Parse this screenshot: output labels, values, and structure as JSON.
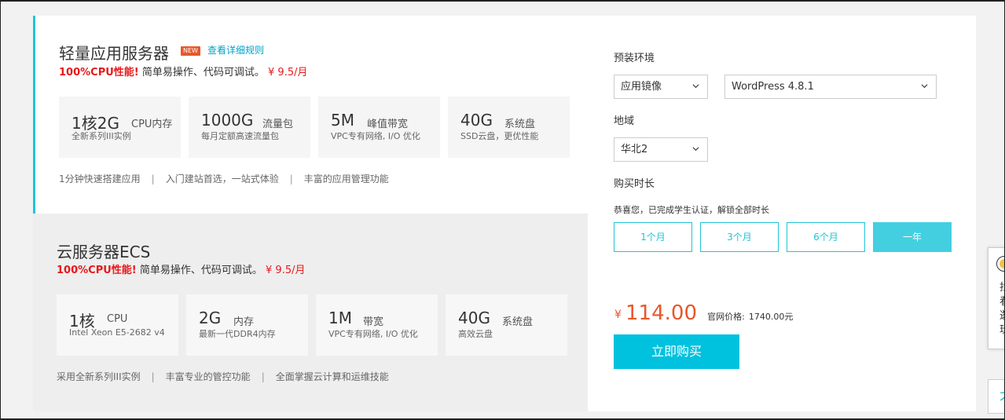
{
  "lightweight": {
    "title": "轻量应用服务器",
    "badge": "NEW",
    "rule_link": "查看详细规则",
    "desc_highlight": "100%CPU性能!",
    "desc_text": "简单易操作、代码可调试。",
    "desc_price": "¥ 9.5/月",
    "specs": [
      {
        "big": "1核2G",
        "unit": "CPU内存",
        "sub": "全新系列III实例"
      },
      {
        "big": "1000G",
        "unit": "流量包",
        "sub": "每月定额高速流量包"
      },
      {
        "big": "5M",
        "unit": "峰值带宽",
        "sub": "VPC专有网络, I/O 优化"
      },
      {
        "big": "40G",
        "unit": "系统盘",
        "sub": "SSD云盘，更优性能"
      }
    ],
    "features": [
      "1分钟快速搭建应用",
      "入门建站首选，一站式体验",
      "丰富的应用管理功能"
    ]
  },
  "ecs": {
    "title": "云服务器ECS",
    "desc_highlight": "100%CPU性能!",
    "desc_text": "简单易操作、代码可调试。",
    "desc_price": "¥ 9.5/月",
    "specs": [
      {
        "big": "1核",
        "unit": "CPU",
        "sub": "Intel Xeon E5-2682 v4"
      },
      {
        "big": "2G",
        "unit": "内存",
        "sub": "最新一代DDR4内存"
      },
      {
        "big": "1M",
        "unit": "带宽",
        "sub": "VPC专有网络, I/O 优化"
      },
      {
        "big": "40G",
        "unit": "系统盘",
        "sub": "高效云盘"
      }
    ],
    "features": [
      "采用全新系列III实例",
      "丰富专业的管控功能",
      "全面掌握云计算和运维技能"
    ]
  },
  "config": {
    "env_label": "预装环境",
    "env_type": "应用镜像",
    "env_image": "WordPress 4.8.1",
    "region_label": "地域",
    "region": "华北2",
    "duration_label": "购买时长",
    "student_note": "恭喜您，已完成学生认证，解锁全部时长",
    "durations": [
      "1个月",
      "3个月",
      "6个月",
      "一年"
    ],
    "active_duration_index": 3,
    "price_symbol": "¥",
    "price": "114.00",
    "orig_price_label": "官网价格:",
    "orig_price": "1740.00元",
    "buy_label": "立即购买"
  },
  "side_widget": {
    "chars": [
      "找",
      "看",
      "逛",
      "玩"
    ],
    "bottom_char": "不"
  },
  "colors": {
    "accent": "#1fc5d6",
    "buy_button": "#00c1de",
    "price": "#e8572a",
    "highlight_red": "#e8191a"
  }
}
